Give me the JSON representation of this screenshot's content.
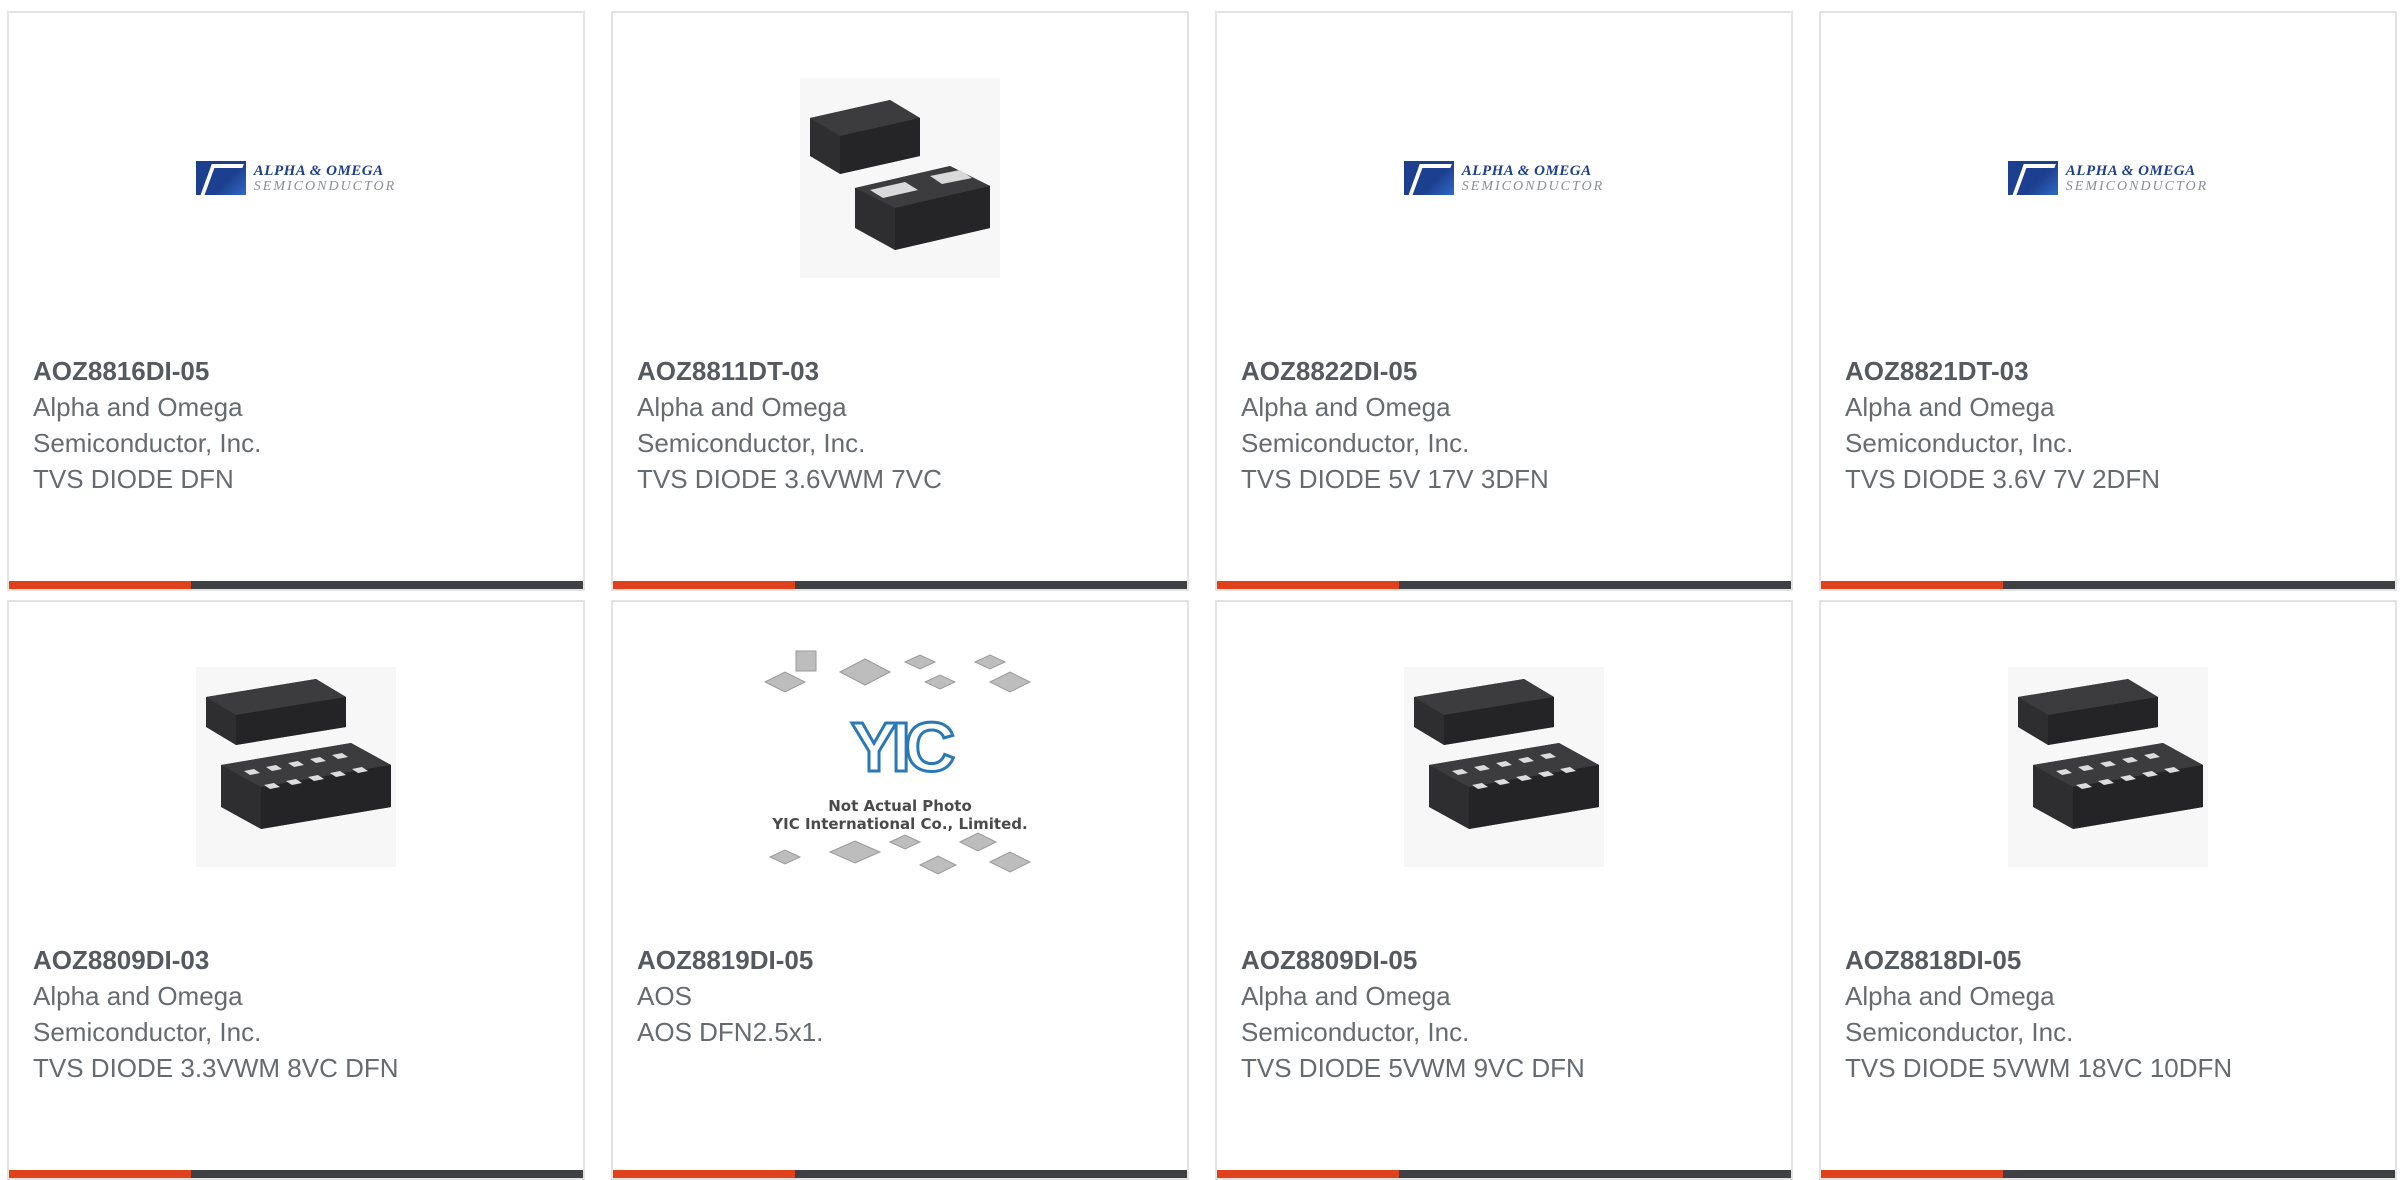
{
  "products": [
    {
      "part": "AOZ8816DI-05",
      "maker": "Alpha and Omega Semiconductor, Inc.",
      "desc": "TVS DIODE DFN",
      "image": "aos-logo"
    },
    {
      "part": "AOZ8811DT-03",
      "maker": "Alpha and Omega Semiconductor, Inc.",
      "desc": "TVS DIODE 3.6VWM 7VC",
      "image": "dfn2-package"
    },
    {
      "part": "AOZ8822DI-05",
      "maker": "Alpha and Omega Semiconductor, Inc.",
      "desc": "TVS DIODE 5V 17V 3DFN",
      "image": "aos-logo"
    },
    {
      "part": "AOZ8821DT-03",
      "maker": "Alpha and Omega Semiconductor, Inc.",
      "desc": "TVS DIODE 3.6V 7V 2DFN",
      "image": "aos-logo"
    },
    {
      "part": "AOZ8809DI-03",
      "maker": "Alpha and Omega Semiconductor, Inc.",
      "desc": "TVS DIODE 3.3VWM 8VC DFN",
      "image": "dfn10-package"
    },
    {
      "part": "AOZ8819DI-05",
      "maker": "AOS",
      "desc": "AOS DFN2.5x1.",
      "image": "placeholder-photo"
    },
    {
      "part": "AOZ8809DI-05",
      "maker": "Alpha and Omega Semiconductor, Inc.",
      "desc": "TVS DIODE 5VWM 9VC DFN",
      "image": "dfn10-package"
    },
    {
      "part": "AOZ8818DI-05",
      "maker": "Alpha and Omega Semiconductor, Inc.",
      "desc": "TVS DIODE 5VWM 18VC 10DFN",
      "image": "dfn10-package"
    }
  ],
  "logo": {
    "line1": "ALPHA & OMEGA",
    "line2": "SEMICONDUCTOR"
  },
  "placeholder": {
    "mark": "YIC",
    "line1": "Not Actual Photo",
    "line2": "YIC International Co., Limited."
  },
  "colors": {
    "accent": "#e0401c",
    "bar": "#3e4043",
    "border": "#e3e3e3",
    "part_text": "#555a60",
    "body_text": "#666b70"
  }
}
